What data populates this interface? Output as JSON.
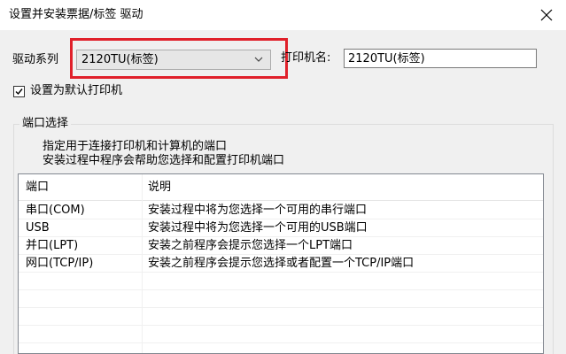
{
  "window": {
    "title": "设置并安装票据/标签 驱动"
  },
  "driver": {
    "series_label": "驱动系列",
    "series_value": "2120TU(标签)",
    "printer_name_label": "打印机名:",
    "printer_name_value": "2120TU(标签)"
  },
  "default_printer": {
    "label": "设置为默认打印机",
    "checked": true
  },
  "port_group": {
    "title": "端口选择",
    "description_line1": "指定用于连接打印机和计算机的端口",
    "description_line2": "安装过程中程序会帮助您选择和配置打印机端口",
    "columns": [
      "端口",
      "说明"
    ],
    "rows": [
      [
        "串口(COM)",
        "安装过程中将为您选择一个可用的串行端口"
      ],
      [
        "USB",
        "安装过程中将为您选择一个可用的USB端口"
      ],
      [
        "并口(LPT)",
        "安装之前程序会提示您选择一个LPT端口"
      ],
      [
        "网口(TCP/IP)",
        "安装之前程序会提示您选择或者配置一个TCP/IP端口"
      ]
    ]
  },
  "colors": {
    "highlight": "#e0202a",
    "background": "#f0f0f0"
  },
  "icons": {
    "close": "close-icon",
    "dropdown": "chevron-down-icon",
    "check": "check-icon"
  }
}
